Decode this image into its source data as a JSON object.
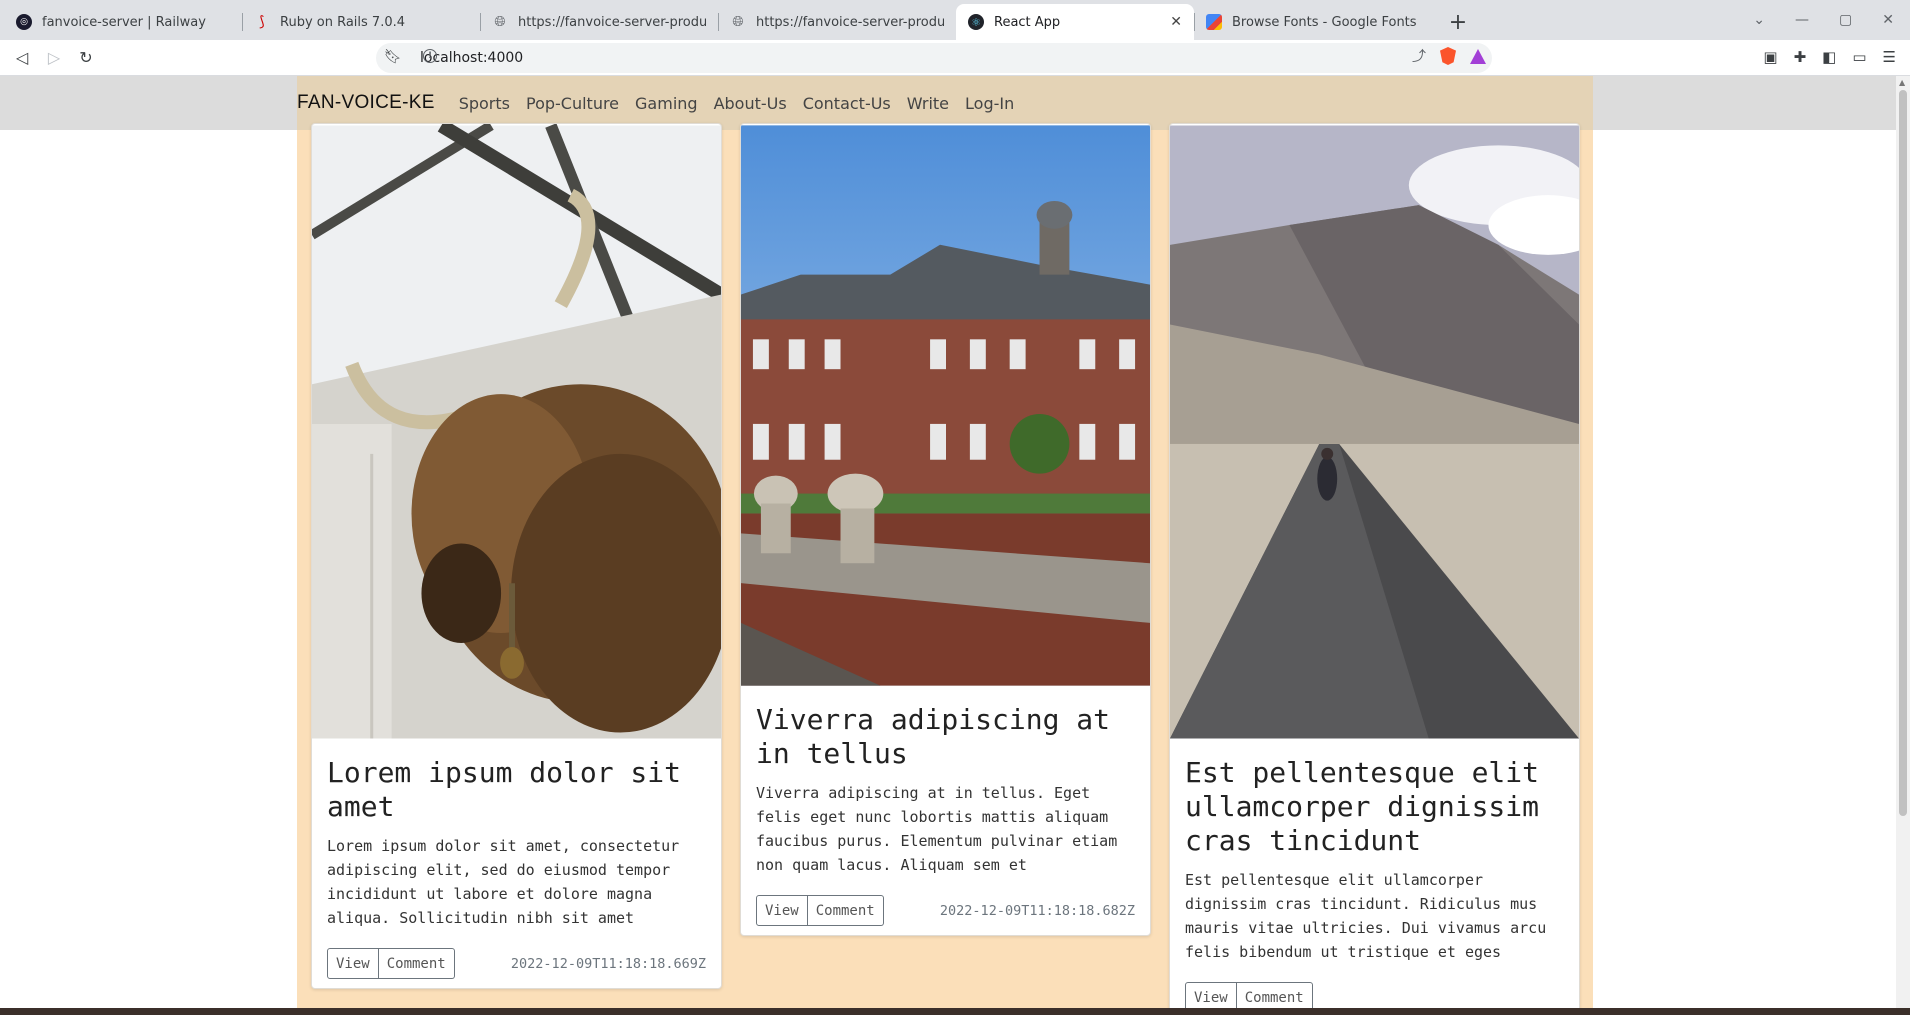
{
  "browser": {
    "tabs": [
      {
        "title": "fanvoice-server | Railway",
        "icon": "railway-icon",
        "active": false
      },
      {
        "title": "Ruby on Rails 7.0.4",
        "icon": "rails-icon",
        "active": false
      },
      {
        "title": "https://fanvoice-server-productio",
        "icon": "globe-icon",
        "active": false
      },
      {
        "title": "https://fanvoice-server-productio",
        "icon": "globe-icon",
        "active": false
      },
      {
        "title": "React App",
        "icon": "react-icon",
        "active": true
      },
      {
        "title": "Browse Fonts - Google Fonts",
        "icon": "google-fonts-icon",
        "active": false
      }
    ],
    "url": "localhost:4000"
  },
  "page": {
    "brand": "FAN-VOICE-KE",
    "nav": [
      "Sports",
      "Pop-Culture",
      "Gaming",
      "About-Us",
      "Contact-Us",
      "Write",
      "Log-In"
    ],
    "view_label": "View",
    "comment_label": "Comment",
    "colors": {
      "container_bg": "#fbdfb9",
      "navbar_bg": "#dadada"
    },
    "cards": [
      {
        "title": "Lorem ipsum dolor sit amet",
        "text": "Lorem ipsum dolor sit amet, consectetur adipiscing elit, sed do eiusmod tempor incididunt ut labore et dolore magna aliqua. Sollicitudin nibh sit amet",
        "timestamp": "2022-12-09T11:18:18.669Z",
        "image": "highland-cow-photo"
      },
      {
        "title": "Viverra adipiscing at in tellus",
        "text": "Viverra adipiscing at in tellus. Eget felis eget nunc lobortis mattis aliquam faucibus purus. Elementum pulvinar etiam non quam lacus. Aliquam sem et",
        "timestamp": "2022-12-09T11:18:18.682Z",
        "image": "manor-house-photo"
      },
      {
        "title": "Est pellentesque elit ullamcorper dignissim cras tincidunt",
        "text": "Est pellentesque elit ullamcorper dignissim cras tincidunt. Ridiculus mus mauris vitae ultricies. Dui vivamus arcu felis bibendum ut tristique et eges",
        "timestamp": "",
        "image": "mountain-road-motorcycle-photo"
      }
    ]
  }
}
